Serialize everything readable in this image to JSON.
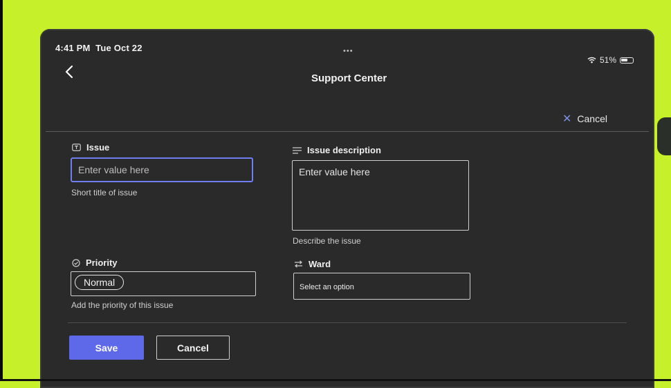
{
  "status_bar": {
    "time": "4:41 PM",
    "date": "Tue Oct 22",
    "dots": "•••",
    "battery": "51%"
  },
  "header": {
    "title": "Support Center",
    "back_icon": "chevron-left-icon"
  },
  "top_actions": {
    "cancel_label": "Cancel",
    "cancel_icon": "close-icon"
  },
  "form": {
    "issue": {
      "label": "Issue",
      "placeholder": "Enter value here",
      "value": "",
      "helper": "Short title of issue"
    },
    "issue_description": {
      "label": "Issue description",
      "placeholder": "Enter value here",
      "value": "",
      "helper": "Describe the issue"
    },
    "priority": {
      "label": "Priority",
      "selected": "Normal",
      "helper": "Add the priority of this issue"
    },
    "ward": {
      "label": "Ward",
      "placeholder": "Select an option"
    }
  },
  "footer": {
    "save_label": "Save",
    "cancel_label": "Cancel"
  },
  "colors": {
    "accent": "#5d69e9",
    "focus_border": "#6f7ff0",
    "background": "#2a2a2a",
    "case": "#c6f02a"
  }
}
